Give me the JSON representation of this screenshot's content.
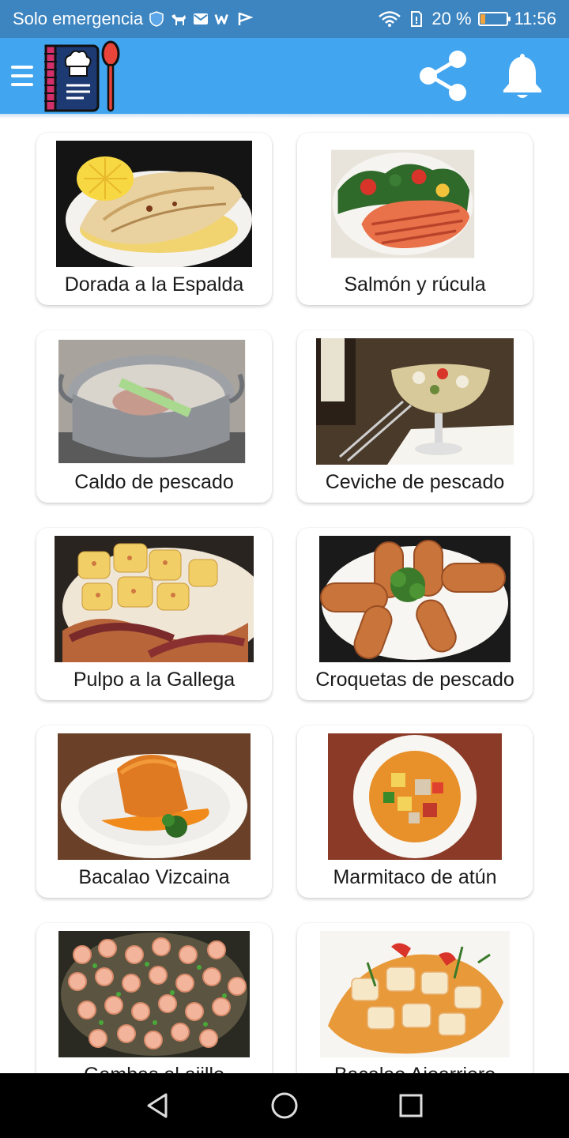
{
  "status_bar": {
    "carrier": "Solo emergencia",
    "battery_text": "20 %",
    "battery_level": 0.2,
    "time": "11:56",
    "icons": [
      "shield-icon",
      "dog-icon",
      "mail-icon",
      "w-icon",
      "check-flag-icon",
      "wifi-icon",
      "sim-icon",
      "battery-icon"
    ]
  },
  "app_bar": {
    "menu_icon": "menu-icon",
    "logo_icon": "recipe-book-icon",
    "share_icon": "share-icon",
    "notification_icon": "bell-icon"
  },
  "recipes": [
    {
      "title": "Dorada a la Espalda",
      "image": "grilled-fish-with-lemon"
    },
    {
      "title": "Salmón y rúcula",
      "image": "salmon-with-salad"
    },
    {
      "title": "Caldo de pescado",
      "image": "fish-broth-pot"
    },
    {
      "title": "Ceviche de pescado",
      "image": "ceviche-glass"
    },
    {
      "title": "Pulpo a la Gallega",
      "image": "octopus-with-potatoes"
    },
    {
      "title": "Croquetas de pescado",
      "image": "fish-croquettes"
    },
    {
      "title": "Bacalao Vizcaina",
      "image": "cod-in-sauce"
    },
    {
      "title": "Marmitaco de atún",
      "image": "tuna-stew-bowl"
    },
    {
      "title": "Gambas al ajillo",
      "image": "garlic-shrimp"
    },
    {
      "title": "Bacalao Ajoarriero",
      "image": "cod-with-peppers"
    }
  ],
  "nav_bar": {
    "back_icon": "back-icon",
    "home_icon": "home-icon",
    "recents_icon": "recents-icon"
  },
  "colors": {
    "status_bar": "#3d85c0",
    "app_bar": "#42a5f0",
    "accent_red": "#e8443a",
    "card_text": "#1a1a1a"
  }
}
